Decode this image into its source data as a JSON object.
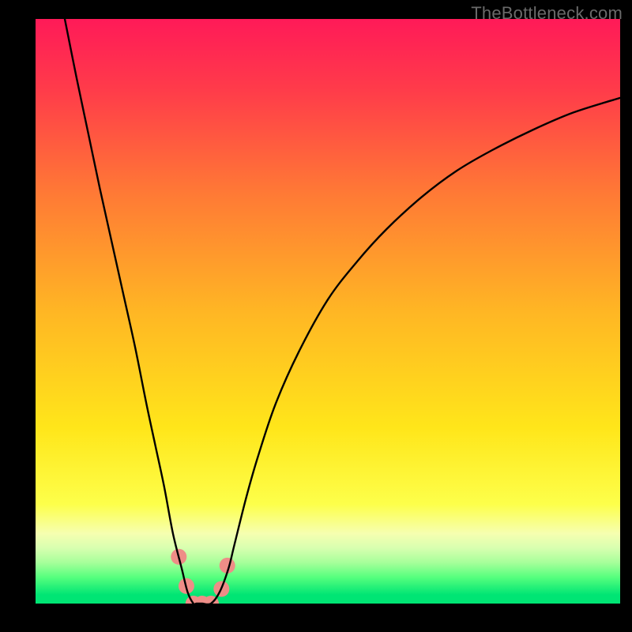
{
  "watermark": "TheBottleneck.com",
  "chart_data": {
    "type": "line",
    "title": "",
    "xlabel": "",
    "ylabel": "",
    "xlim": [
      0,
      100
    ],
    "ylim": [
      0,
      100
    ],
    "grid": false,
    "legend": false,
    "background_gradient": {
      "stops": [
        {
          "offset": 0.0,
          "color": "#ff1a58"
        },
        {
          "offset": 0.12,
          "color": "#ff3b4a"
        },
        {
          "offset": 0.3,
          "color": "#ff7a35"
        },
        {
          "offset": 0.5,
          "color": "#ffb624"
        },
        {
          "offset": 0.7,
          "color": "#ffe61a"
        },
        {
          "offset": 0.83,
          "color": "#fdff4a"
        },
        {
          "offset": 0.88,
          "color": "#f6ffb0"
        },
        {
          "offset": 0.905,
          "color": "#d8ffb0"
        },
        {
          "offset": 0.93,
          "color": "#a6ff9a"
        },
        {
          "offset": 0.955,
          "color": "#56ff7e"
        },
        {
          "offset": 0.985,
          "color": "#00e574"
        },
        {
          "offset": 1.0,
          "color": "#00e574"
        }
      ]
    },
    "series": [
      {
        "name": "bottleneck-curve",
        "color": "#000000",
        "x": [
          5,
          7,
          9,
          11,
          13,
          15,
          17,
          19,
          20.5,
          22,
          23.5,
          25,
          26,
          27,
          27.5,
          28.5,
          30,
          31.5,
          33,
          34,
          36,
          38,
          41,
          45,
          50,
          55,
          60,
          66,
          72,
          78,
          85,
          92,
          100
        ],
        "y": [
          100,
          90,
          80.5,
          71,
          62,
          53,
          44,
          34,
          27,
          20,
          12,
          6,
          2,
          0,
          0,
          0,
          0,
          2,
          6,
          10,
          18,
          25,
          34,
          43,
          52,
          58.5,
          64,
          69.5,
          74,
          77.5,
          81,
          84,
          86.5
        ]
      }
    ],
    "markers": {
      "name": "highlight-dots",
      "color": "#ee8d87",
      "radius_px": 10,
      "points": [
        {
          "x": 24.5,
          "y": 8
        },
        {
          "x": 25.8,
          "y": 3
        },
        {
          "x": 27.0,
          "y": 0
        },
        {
          "x": 28.5,
          "y": 0
        },
        {
          "x": 30.0,
          "y": 0
        },
        {
          "x": 31.8,
          "y": 2.5
        },
        {
          "x": 32.8,
          "y": 6.5
        }
      ]
    }
  }
}
